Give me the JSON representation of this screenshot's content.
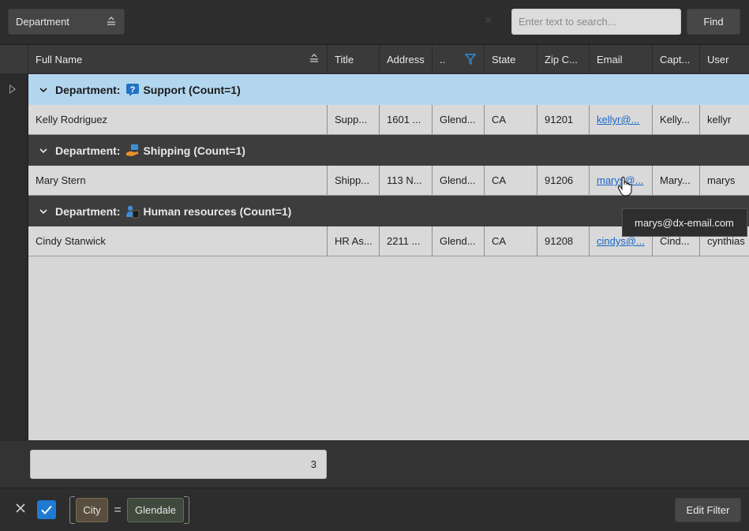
{
  "group_panel": {
    "group_column": "Department"
  },
  "search": {
    "placeholder": "Enter text to search...",
    "value": "",
    "clear_glyph": "×",
    "find_label": "Find"
  },
  "columns": [
    "Full Name",
    "Title",
    "Address",
    "..",
    "State",
    "Zip C...",
    "Email",
    "Capt...",
    "User"
  ],
  "groups": [
    {
      "header": "Department:",
      "name": "Support (Count=1)",
      "icon": "support-question-icon",
      "focused": true,
      "row": [
        "Kelly Rodriguez",
        "Supp...",
        "1601 ...",
        "Glend...",
        "CA",
        "91201",
        "kellyr@...",
        "Kelly...",
        "kellyr"
      ]
    },
    {
      "header": "Department:",
      "name": "Shipping (Count=1)",
      "icon": "shipping-hand-icon",
      "focused": false,
      "row": [
        "Mary Stern",
        "Shipp...",
        "113 N...",
        "Glend...",
        "CA",
        "91206",
        "marys@...",
        "Mary...",
        "marys"
      ]
    },
    {
      "header": "Department:",
      "name": "Human resources (Count=1)",
      "icon": "human-resources-icon",
      "focused": false,
      "row": [
        "Cindy Stanwick",
        "HR As...",
        "2211 ...",
        "Glend...",
        "CA",
        "91208",
        "cindys@...",
        "Cind...",
        "cynthias"
      ]
    }
  ],
  "tooltip": {
    "text": "marys@dx-email.com"
  },
  "footer": {
    "total_count": "3"
  },
  "filter": {
    "field": "City",
    "operator": "=",
    "value": "Glendale",
    "enabled": true,
    "edit_label": "Edit Filter"
  },
  "colors": {
    "focused_group": "#b3d6ef",
    "link": "#1a66c9",
    "checkbox": "#1f7ad1",
    "filter_icon": "#2a8fdc"
  }
}
